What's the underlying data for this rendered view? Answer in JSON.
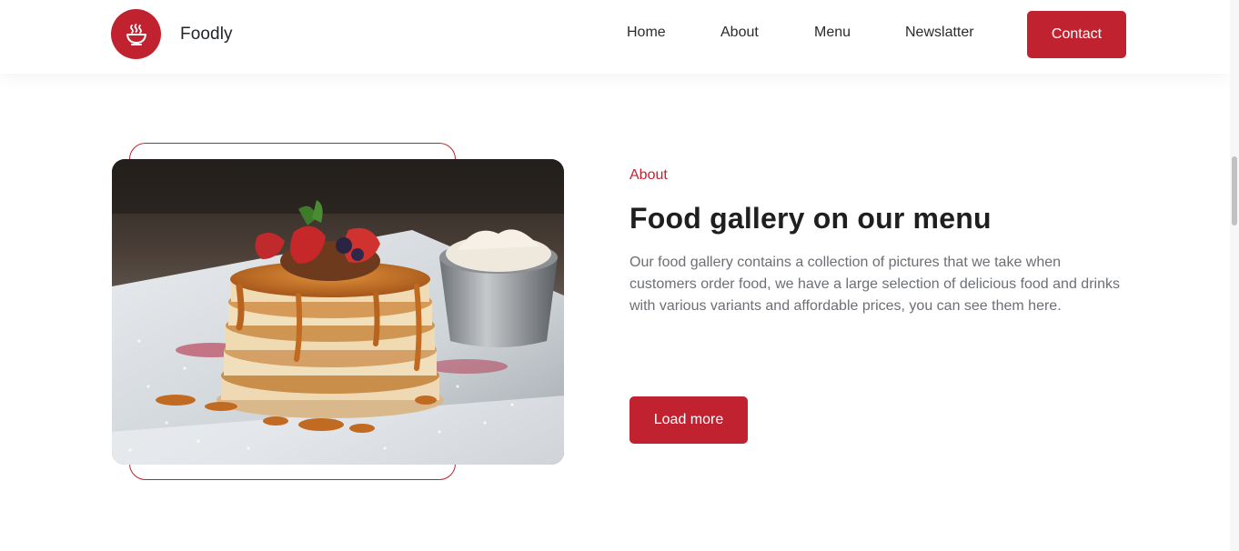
{
  "brand": {
    "name": "Foodly",
    "logo_icon": "bowl-steam-icon"
  },
  "nav": {
    "items": [
      {
        "label": "Home"
      },
      {
        "label": "About"
      },
      {
        "label": "Menu"
      },
      {
        "label": "Newslatter"
      }
    ],
    "contact_label": "Contact"
  },
  "about": {
    "eyebrow": "About",
    "title": "Food gallery on our menu",
    "description": "Our food gallery contains a collection of pictures that we take when customers order food, we have a large selection of delicious food and drinks with various variants and affordable prices, you can see them here.",
    "button_label": "Load more",
    "image_icon": "pancake-photo"
  },
  "colors": {
    "accent": "#c0232f",
    "text_dark": "#1f1f1f",
    "text_muted": "#6c6f75"
  }
}
